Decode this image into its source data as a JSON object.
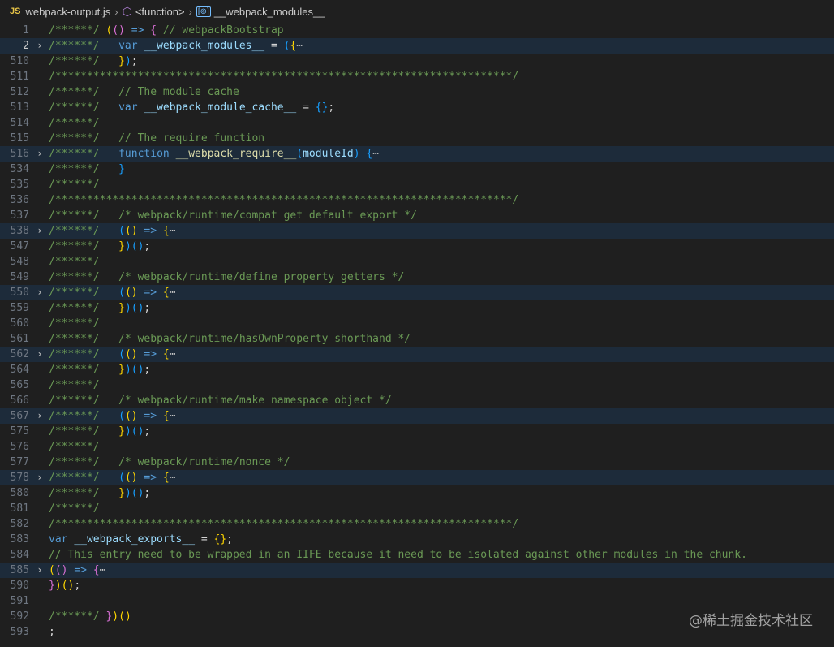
{
  "breadcrumb": {
    "file_icon": "JS",
    "file": "webpack-output.js",
    "function": "<function>",
    "symbol": "__webpack_modules__"
  },
  "lines": [
    {
      "n": "1",
      "fold": "",
      "hl": false,
      "toks": [
        [
          "cm",
          "/******/ "
        ],
        [
          "p1",
          "("
        ],
        [
          "p2",
          "("
        ],
        [
          "p2",
          ")"
        ],
        [
          "op",
          " "
        ],
        [
          "kw",
          "=>"
        ],
        [
          "op",
          " "
        ],
        [
          "p2",
          "{"
        ],
        [
          "op",
          " "
        ],
        [
          "cm",
          "// webpackBootstrap"
        ]
      ]
    },
    {
      "n": "2",
      "fold": "›",
      "hl": true,
      "active": true,
      "toks": [
        [
          "cm",
          "/******/ "
        ],
        [
          "op",
          "\t"
        ],
        [
          "kw",
          "var"
        ],
        [
          "op",
          " "
        ],
        [
          "id",
          "__webpack_modules__"
        ],
        [
          "op",
          " = "
        ],
        [
          "p3",
          "("
        ],
        [
          "p1",
          "{"
        ],
        [
          "ell",
          "⋯"
        ]
      ]
    },
    {
      "n": "510",
      "fold": "",
      "hl": false,
      "toks": [
        [
          "cm",
          "/******/ "
        ],
        [
          "op",
          "\t"
        ],
        [
          "p1",
          "}"
        ],
        [
          "p3",
          ")"
        ],
        [
          "op",
          ";"
        ]
      ]
    },
    {
      "n": "511",
      "fold": "",
      "hl": false,
      "toks": [
        [
          "cm",
          "/************************************************************************/"
        ]
      ]
    },
    {
      "n": "512",
      "fold": "",
      "hl": false,
      "toks": [
        [
          "cm",
          "/******/ "
        ],
        [
          "op",
          "\t"
        ],
        [
          "cm",
          "// The module cache"
        ]
      ]
    },
    {
      "n": "513",
      "fold": "",
      "hl": false,
      "toks": [
        [
          "cm",
          "/******/ "
        ],
        [
          "op",
          "\t"
        ],
        [
          "kw",
          "var"
        ],
        [
          "op",
          " "
        ],
        [
          "id",
          "__webpack_module_cache__"
        ],
        [
          "op",
          " = "
        ],
        [
          "p3",
          "{}"
        ],
        [
          "op",
          ";"
        ]
      ]
    },
    {
      "n": "514",
      "fold": "",
      "hl": false,
      "toks": [
        [
          "cm",
          "/******/ "
        ]
      ]
    },
    {
      "n": "515",
      "fold": "",
      "hl": false,
      "toks": [
        [
          "cm",
          "/******/ "
        ],
        [
          "op",
          "\t"
        ],
        [
          "cm",
          "// The require function"
        ]
      ]
    },
    {
      "n": "516",
      "fold": "›",
      "hl": true,
      "toks": [
        [
          "cm",
          "/******/ "
        ],
        [
          "op",
          "\t"
        ],
        [
          "kw",
          "function"
        ],
        [
          "op",
          " "
        ],
        [
          "fn",
          "__webpack_require__"
        ],
        [
          "p3",
          "("
        ],
        [
          "id",
          "moduleId"
        ],
        [
          "p3",
          ")"
        ],
        [
          "op",
          " "
        ],
        [
          "p3",
          "{"
        ],
        [
          "ell",
          "⋯"
        ]
      ]
    },
    {
      "n": "534",
      "fold": "",
      "hl": false,
      "toks": [
        [
          "cm",
          "/******/ "
        ],
        [
          "op",
          "\t"
        ],
        [
          "p3",
          "}"
        ]
      ]
    },
    {
      "n": "535",
      "fold": "",
      "hl": false,
      "toks": [
        [
          "cm",
          "/******/ "
        ]
      ]
    },
    {
      "n": "536",
      "fold": "",
      "hl": false,
      "toks": [
        [
          "cm",
          "/************************************************************************/"
        ]
      ]
    },
    {
      "n": "537",
      "fold": "",
      "hl": false,
      "toks": [
        [
          "cm",
          "/******/ "
        ],
        [
          "op",
          "\t"
        ],
        [
          "cm",
          "/* webpack/runtime/compat get default export */"
        ]
      ]
    },
    {
      "n": "538",
      "fold": "›",
      "hl": true,
      "toks": [
        [
          "cm",
          "/******/ "
        ],
        [
          "op",
          "\t"
        ],
        [
          "p3",
          "("
        ],
        [
          "p1",
          "("
        ],
        [
          "p1",
          ")"
        ],
        [
          "op",
          " "
        ],
        [
          "kw",
          "=>"
        ],
        [
          "op",
          " "
        ],
        [
          "p1",
          "{"
        ],
        [
          "ell",
          "⋯"
        ]
      ]
    },
    {
      "n": "547",
      "fold": "",
      "hl": false,
      "toks": [
        [
          "cm",
          "/******/ "
        ],
        [
          "op",
          "\t"
        ],
        [
          "p1",
          "}"
        ],
        [
          "p3",
          ")"
        ],
        [
          "p3",
          "("
        ],
        [
          "p3",
          ")"
        ],
        [
          "op",
          ";"
        ]
      ]
    },
    {
      "n": "548",
      "fold": "",
      "hl": false,
      "toks": [
        [
          "cm",
          "/******/ "
        ]
      ]
    },
    {
      "n": "549",
      "fold": "",
      "hl": false,
      "toks": [
        [
          "cm",
          "/******/ "
        ],
        [
          "op",
          "\t"
        ],
        [
          "cm",
          "/* webpack/runtime/define property getters */"
        ]
      ]
    },
    {
      "n": "550",
      "fold": "›",
      "hl": true,
      "toks": [
        [
          "cm",
          "/******/ "
        ],
        [
          "op",
          "\t"
        ],
        [
          "p3",
          "("
        ],
        [
          "p1",
          "("
        ],
        [
          "p1",
          ")"
        ],
        [
          "op",
          " "
        ],
        [
          "kw",
          "=>"
        ],
        [
          "op",
          " "
        ],
        [
          "p1",
          "{"
        ],
        [
          "ell",
          "⋯"
        ]
      ]
    },
    {
      "n": "559",
      "fold": "",
      "hl": false,
      "toks": [
        [
          "cm",
          "/******/ "
        ],
        [
          "op",
          "\t"
        ],
        [
          "p1",
          "}"
        ],
        [
          "p3",
          ")"
        ],
        [
          "p3",
          "("
        ],
        [
          "p3",
          ")"
        ],
        [
          "op",
          ";"
        ]
      ]
    },
    {
      "n": "560",
      "fold": "",
      "hl": false,
      "toks": [
        [
          "cm",
          "/******/ "
        ]
      ]
    },
    {
      "n": "561",
      "fold": "",
      "hl": false,
      "toks": [
        [
          "cm",
          "/******/ "
        ],
        [
          "op",
          "\t"
        ],
        [
          "cm",
          "/* webpack/runtime/hasOwnProperty shorthand */"
        ]
      ]
    },
    {
      "n": "562",
      "fold": "›",
      "hl": true,
      "toks": [
        [
          "cm",
          "/******/ "
        ],
        [
          "op",
          "\t"
        ],
        [
          "p3",
          "("
        ],
        [
          "p1",
          "("
        ],
        [
          "p1",
          ")"
        ],
        [
          "op",
          " "
        ],
        [
          "kw",
          "=>"
        ],
        [
          "op",
          " "
        ],
        [
          "p1",
          "{"
        ],
        [
          "ell",
          "⋯"
        ]
      ]
    },
    {
      "n": "564",
      "fold": "",
      "hl": false,
      "toks": [
        [
          "cm",
          "/******/ "
        ],
        [
          "op",
          "\t"
        ],
        [
          "p1",
          "}"
        ],
        [
          "p3",
          ")"
        ],
        [
          "p3",
          "("
        ],
        [
          "p3",
          ")"
        ],
        [
          "op",
          ";"
        ]
      ]
    },
    {
      "n": "565",
      "fold": "",
      "hl": false,
      "toks": [
        [
          "cm",
          "/******/ "
        ]
      ]
    },
    {
      "n": "566",
      "fold": "",
      "hl": false,
      "toks": [
        [
          "cm",
          "/******/ "
        ],
        [
          "op",
          "\t"
        ],
        [
          "cm",
          "/* webpack/runtime/make namespace object */"
        ]
      ]
    },
    {
      "n": "567",
      "fold": "›",
      "hl": true,
      "toks": [
        [
          "cm",
          "/******/ "
        ],
        [
          "op",
          "\t"
        ],
        [
          "p3",
          "("
        ],
        [
          "p1",
          "("
        ],
        [
          "p1",
          ")"
        ],
        [
          "op",
          " "
        ],
        [
          "kw",
          "=>"
        ],
        [
          "op",
          " "
        ],
        [
          "p1",
          "{"
        ],
        [
          "ell",
          "⋯"
        ]
      ]
    },
    {
      "n": "575",
      "fold": "",
      "hl": false,
      "toks": [
        [
          "cm",
          "/******/ "
        ],
        [
          "op",
          "\t"
        ],
        [
          "p1",
          "}"
        ],
        [
          "p3",
          ")"
        ],
        [
          "p3",
          "("
        ],
        [
          "p3",
          ")"
        ],
        [
          "op",
          ";"
        ]
      ]
    },
    {
      "n": "576",
      "fold": "",
      "hl": false,
      "toks": [
        [
          "cm",
          "/******/ "
        ]
      ]
    },
    {
      "n": "577",
      "fold": "",
      "hl": false,
      "toks": [
        [
          "cm",
          "/******/ "
        ],
        [
          "op",
          "\t"
        ],
        [
          "cm",
          "/* webpack/runtime/nonce */"
        ]
      ]
    },
    {
      "n": "578",
      "fold": "›",
      "hl": true,
      "toks": [
        [
          "cm",
          "/******/ "
        ],
        [
          "op",
          "\t"
        ],
        [
          "p3",
          "("
        ],
        [
          "p1",
          "("
        ],
        [
          "p1",
          ")"
        ],
        [
          "op",
          " "
        ],
        [
          "kw",
          "=>"
        ],
        [
          "op",
          " "
        ],
        [
          "p1",
          "{"
        ],
        [
          "ell",
          "⋯"
        ]
      ]
    },
    {
      "n": "580",
      "fold": "",
      "hl": false,
      "toks": [
        [
          "cm",
          "/******/ "
        ],
        [
          "op",
          "\t"
        ],
        [
          "p1",
          "}"
        ],
        [
          "p3",
          ")"
        ],
        [
          "p3",
          "("
        ],
        [
          "p3",
          ")"
        ],
        [
          "op",
          ";"
        ]
      ]
    },
    {
      "n": "581",
      "fold": "",
      "hl": false,
      "toks": [
        [
          "cm",
          "/******/ "
        ]
      ]
    },
    {
      "n": "582",
      "fold": "",
      "hl": false,
      "toks": [
        [
          "cm",
          "/************************************************************************/"
        ]
      ]
    },
    {
      "n": "583",
      "fold": "",
      "hl": false,
      "toks": [
        [
          "kw",
          "var"
        ],
        [
          "op",
          " "
        ],
        [
          "id",
          "__webpack_exports__"
        ],
        [
          "op",
          " = "
        ],
        [
          "p1",
          "{}"
        ],
        [
          "op",
          ";"
        ]
      ]
    },
    {
      "n": "584",
      "fold": "",
      "hl": false,
      "toks": [
        [
          "cm",
          "// This entry need to be wrapped in an IIFE because it need to be isolated against other modules in the chunk."
        ]
      ]
    },
    {
      "n": "585",
      "fold": "›",
      "hl": true,
      "toks": [
        [
          "p1",
          "("
        ],
        [
          "p2",
          "("
        ],
        [
          "p2",
          ")"
        ],
        [
          "op",
          " "
        ],
        [
          "kw",
          "=>"
        ],
        [
          "op",
          " "
        ],
        [
          "p2",
          "{"
        ],
        [
          "ell",
          "⋯"
        ]
      ]
    },
    {
      "n": "590",
      "fold": "",
      "hl": false,
      "toks": [
        [
          "p2",
          "}"
        ],
        [
          "p1",
          ")"
        ],
        [
          "p1",
          "("
        ],
        [
          "p1",
          ")"
        ],
        [
          "op",
          ";"
        ]
      ]
    },
    {
      "n": "591",
      "fold": "",
      "hl": false,
      "toks": []
    },
    {
      "n": "592",
      "fold": "",
      "hl": false,
      "toks": [
        [
          "cm",
          "/******/ "
        ],
        [
          "p2",
          "}"
        ],
        [
          "p1",
          ")"
        ],
        [
          "p1",
          "("
        ],
        [
          "p1",
          ")"
        ]
      ]
    },
    {
      "n": "593",
      "fold": "",
      "hl": false,
      "toks": [
        [
          "op",
          ";"
        ]
      ]
    }
  ],
  "watermark": "@稀土掘金技术社区"
}
